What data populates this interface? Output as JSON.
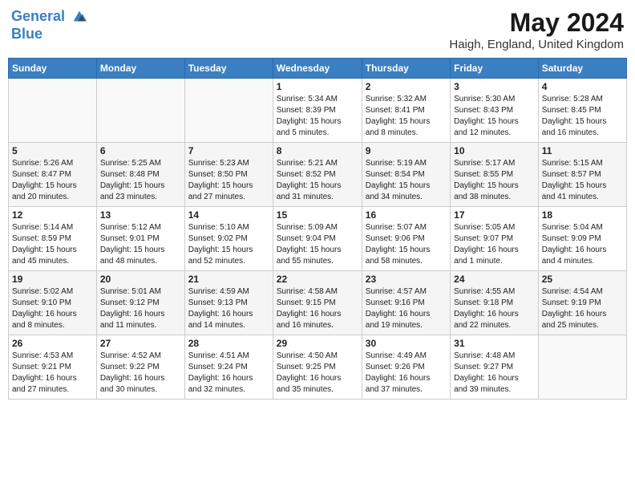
{
  "header": {
    "logo_line1": "General",
    "logo_line2": "Blue",
    "month_year": "May 2024",
    "location": "Haigh, England, United Kingdom"
  },
  "weekdays": [
    "Sunday",
    "Monday",
    "Tuesday",
    "Wednesday",
    "Thursday",
    "Friday",
    "Saturday"
  ],
  "weeks": [
    [
      {
        "day": "",
        "info": ""
      },
      {
        "day": "",
        "info": ""
      },
      {
        "day": "",
        "info": ""
      },
      {
        "day": "1",
        "info": "Sunrise: 5:34 AM\nSunset: 8:39 PM\nDaylight: 15 hours\nand 5 minutes."
      },
      {
        "day": "2",
        "info": "Sunrise: 5:32 AM\nSunset: 8:41 PM\nDaylight: 15 hours\nand 8 minutes."
      },
      {
        "day": "3",
        "info": "Sunrise: 5:30 AM\nSunset: 8:43 PM\nDaylight: 15 hours\nand 12 minutes."
      },
      {
        "day": "4",
        "info": "Sunrise: 5:28 AM\nSunset: 8:45 PM\nDaylight: 15 hours\nand 16 minutes."
      }
    ],
    [
      {
        "day": "5",
        "info": "Sunrise: 5:26 AM\nSunset: 8:47 PM\nDaylight: 15 hours\nand 20 minutes."
      },
      {
        "day": "6",
        "info": "Sunrise: 5:25 AM\nSunset: 8:48 PM\nDaylight: 15 hours\nand 23 minutes."
      },
      {
        "day": "7",
        "info": "Sunrise: 5:23 AM\nSunset: 8:50 PM\nDaylight: 15 hours\nand 27 minutes."
      },
      {
        "day": "8",
        "info": "Sunrise: 5:21 AM\nSunset: 8:52 PM\nDaylight: 15 hours\nand 31 minutes."
      },
      {
        "day": "9",
        "info": "Sunrise: 5:19 AM\nSunset: 8:54 PM\nDaylight: 15 hours\nand 34 minutes."
      },
      {
        "day": "10",
        "info": "Sunrise: 5:17 AM\nSunset: 8:55 PM\nDaylight: 15 hours\nand 38 minutes."
      },
      {
        "day": "11",
        "info": "Sunrise: 5:15 AM\nSunset: 8:57 PM\nDaylight: 15 hours\nand 41 minutes."
      }
    ],
    [
      {
        "day": "12",
        "info": "Sunrise: 5:14 AM\nSunset: 8:59 PM\nDaylight: 15 hours\nand 45 minutes."
      },
      {
        "day": "13",
        "info": "Sunrise: 5:12 AM\nSunset: 9:01 PM\nDaylight: 15 hours\nand 48 minutes."
      },
      {
        "day": "14",
        "info": "Sunrise: 5:10 AM\nSunset: 9:02 PM\nDaylight: 15 hours\nand 52 minutes."
      },
      {
        "day": "15",
        "info": "Sunrise: 5:09 AM\nSunset: 9:04 PM\nDaylight: 15 hours\nand 55 minutes."
      },
      {
        "day": "16",
        "info": "Sunrise: 5:07 AM\nSunset: 9:06 PM\nDaylight: 15 hours\nand 58 minutes."
      },
      {
        "day": "17",
        "info": "Sunrise: 5:05 AM\nSunset: 9:07 PM\nDaylight: 16 hours\nand 1 minute."
      },
      {
        "day": "18",
        "info": "Sunrise: 5:04 AM\nSunset: 9:09 PM\nDaylight: 16 hours\nand 4 minutes."
      }
    ],
    [
      {
        "day": "19",
        "info": "Sunrise: 5:02 AM\nSunset: 9:10 PM\nDaylight: 16 hours\nand 8 minutes."
      },
      {
        "day": "20",
        "info": "Sunrise: 5:01 AM\nSunset: 9:12 PM\nDaylight: 16 hours\nand 11 minutes."
      },
      {
        "day": "21",
        "info": "Sunrise: 4:59 AM\nSunset: 9:13 PM\nDaylight: 16 hours\nand 14 minutes."
      },
      {
        "day": "22",
        "info": "Sunrise: 4:58 AM\nSunset: 9:15 PM\nDaylight: 16 hours\nand 16 minutes."
      },
      {
        "day": "23",
        "info": "Sunrise: 4:57 AM\nSunset: 9:16 PM\nDaylight: 16 hours\nand 19 minutes."
      },
      {
        "day": "24",
        "info": "Sunrise: 4:55 AM\nSunset: 9:18 PM\nDaylight: 16 hours\nand 22 minutes."
      },
      {
        "day": "25",
        "info": "Sunrise: 4:54 AM\nSunset: 9:19 PM\nDaylight: 16 hours\nand 25 minutes."
      }
    ],
    [
      {
        "day": "26",
        "info": "Sunrise: 4:53 AM\nSunset: 9:21 PM\nDaylight: 16 hours\nand 27 minutes."
      },
      {
        "day": "27",
        "info": "Sunrise: 4:52 AM\nSunset: 9:22 PM\nDaylight: 16 hours\nand 30 minutes."
      },
      {
        "day": "28",
        "info": "Sunrise: 4:51 AM\nSunset: 9:24 PM\nDaylight: 16 hours\nand 32 minutes."
      },
      {
        "day": "29",
        "info": "Sunrise: 4:50 AM\nSunset: 9:25 PM\nDaylight: 16 hours\nand 35 minutes."
      },
      {
        "day": "30",
        "info": "Sunrise: 4:49 AM\nSunset: 9:26 PM\nDaylight: 16 hours\nand 37 minutes."
      },
      {
        "day": "31",
        "info": "Sunrise: 4:48 AM\nSunset: 9:27 PM\nDaylight: 16 hours\nand 39 minutes."
      },
      {
        "day": "",
        "info": ""
      }
    ]
  ]
}
